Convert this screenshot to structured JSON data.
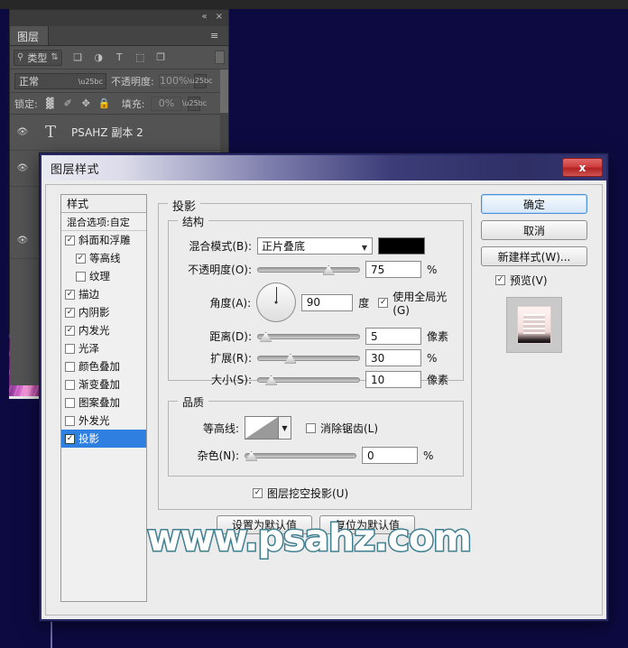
{
  "app": {
    "background_color": "#0d0a42",
    "top_strip_color": "#272727"
  },
  "layers_panel": {
    "tab_label": "图层",
    "collapse_icon": "«",
    "close_icon": "×",
    "menu_icon": "≡",
    "filter": {
      "search_icon": "⚲",
      "type_label": "类型",
      "stepper_icon": "⇅",
      "icons": [
        {
          "name": "pixel-layer-filter-icon",
          "glyph": "❑"
        },
        {
          "name": "adjustment-layer-filter-icon",
          "glyph": "◑"
        },
        {
          "name": "type-layer-filter-icon",
          "glyph": "T"
        },
        {
          "name": "shape-layer-filter-icon",
          "glyph": "⬚"
        },
        {
          "name": "smart-object-filter-icon",
          "glyph": "❐"
        }
      ]
    },
    "blend_mode": "正常",
    "opacity_label": "不透明度:",
    "opacity_value": "100%",
    "lock_label": "锁定:",
    "lock_icons": [
      {
        "name": "lock-transparency-icon",
        "glyph": "▓"
      },
      {
        "name": "lock-image-icon",
        "glyph": "✐"
      },
      {
        "name": "lock-position-icon",
        "glyph": "✥"
      },
      {
        "name": "lock-all-icon",
        "glyph": "ὑ2"
      }
    ],
    "fill_label": "填充:",
    "fill_value": "0%",
    "rows": [
      {
        "name": "PSAHZ 副本 2",
        "type_icon": "T",
        "visible": true
      },
      {
        "name": "",
        "type_icon": "",
        "visible": true
      },
      {
        "name": "",
        "type_icon": "",
        "visible": true
      }
    ]
  },
  "dialog": {
    "title": "图层样式",
    "close_label": "x",
    "styles": {
      "header": "样式",
      "blending_options": "混合选项:自定",
      "items": [
        {
          "label": "斜面和浮雕",
          "checked": true,
          "indent": false,
          "active": false
        },
        {
          "label": "等高线",
          "checked": true,
          "indent": true,
          "active": false
        },
        {
          "label": "纹理",
          "checked": false,
          "indent": true,
          "active": false
        },
        {
          "label": "描边",
          "checked": true,
          "indent": false,
          "active": false
        },
        {
          "label": "内阴影",
          "checked": true,
          "indent": false,
          "active": false
        },
        {
          "label": "内发光",
          "checked": true,
          "indent": false,
          "active": false
        },
        {
          "label": "光泽",
          "checked": false,
          "indent": false,
          "active": false
        },
        {
          "label": "颜色叠加",
          "checked": false,
          "indent": false,
          "active": false
        },
        {
          "label": "渐变叠加",
          "checked": false,
          "indent": false,
          "active": false
        },
        {
          "label": "图案叠加",
          "checked": false,
          "indent": false,
          "active": false
        },
        {
          "label": "外发光",
          "checked": false,
          "indent": false,
          "active": false
        },
        {
          "label": "投影",
          "checked": true,
          "indent": false,
          "active": true
        }
      ]
    },
    "drop_shadow": {
      "group_label": "投影",
      "structure": {
        "label": "结构",
        "blend_mode_label": "混合模式(B):",
        "blend_mode_value": "正片叠底",
        "color": "#000000",
        "opacity_label": "不透明度(O):",
        "opacity_value": "75",
        "opacity_unit": "%",
        "opacity_pct": 72,
        "angle_label": "角度(A):",
        "angle_value": "90",
        "angle_unit": "度",
        "angle_deg": 90,
        "global_light_label": "使用全局光(G)",
        "global_light_checked": true,
        "distance_label": "距离(D):",
        "distance_value": "5",
        "distance_unit": "像素",
        "distance_pct": 3,
        "spread_label": "扩展(R):",
        "spread_value": "30",
        "spread_unit": "%",
        "spread_pct": 30,
        "size_label": "大小(S):",
        "size_value": "10",
        "size_unit": "像素",
        "size_pct": 9
      },
      "quality": {
        "label": "品质",
        "contour_label": "等高线:",
        "antialias_label": "消除锯齿(L)",
        "antialias_checked": false,
        "noise_label": "杂色(N):",
        "noise_value": "0",
        "noise_unit": "%",
        "noise_pct": 1
      },
      "knockout_label": "图层挖空投影(U)",
      "knockout_checked": true,
      "set_default_button": "设置为默认值",
      "reset_default_button": "复位为默认值"
    },
    "buttons": {
      "ok": "确定",
      "cancel": "取消",
      "new_style": "新建样式(W)...",
      "preview_label": "预览(V)",
      "preview_checked": true
    }
  },
  "watermark": {
    "text": "www.psahz.com",
    "fill_color": "#ffffff",
    "stroke_color": "#3f7f90"
  }
}
